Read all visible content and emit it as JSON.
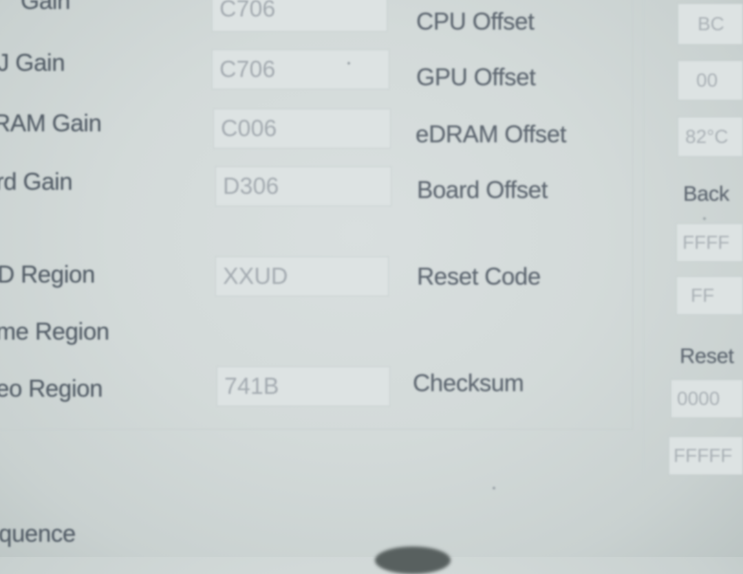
{
  "left_rows": [
    {
      "label": "Gain",
      "value": "C706"
    },
    {
      "label": "J Gain",
      "value": "C706"
    },
    {
      "label": "RAM Gain",
      "value": "C006"
    },
    {
      "label": "rd Gain",
      "value": "D306"
    },
    {
      "label": "D Region",
      "value": "XXUD"
    },
    {
      "label": "me Region",
      "value": ""
    },
    {
      "label": "eo Region",
      "value": "741B"
    }
  ],
  "mid_rows": [
    {
      "label": "CPU Offset"
    },
    {
      "label": "GPU Offset"
    },
    {
      "label": "eDRAM Offset"
    },
    {
      "label": "Board Offset"
    },
    {
      "label": "Reset Code"
    },
    {
      "label": "Checksum"
    }
  ],
  "right_col": {
    "field1": "BC",
    "field2": "00",
    "field3": "82°C",
    "label_back": "Back",
    "field4": "FFFF",
    "field5": "FF",
    "label_reset": "Reset",
    "field6": "0000",
    "field7": "FFFFF"
  },
  "bottom_label": "quence"
}
